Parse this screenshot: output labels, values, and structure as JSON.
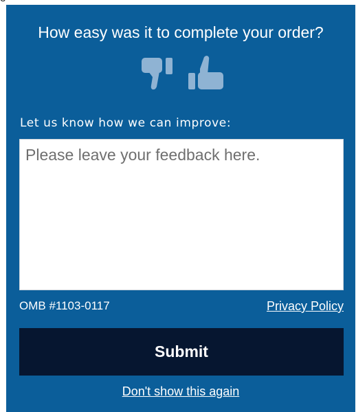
{
  "background_text": "e",
  "survey": {
    "question": "How easy was it to complete your order?",
    "feedback_label": "Let us know how we can improve:",
    "feedback_placeholder": "Please leave your feedback here.",
    "feedback_value": "",
    "omb_number": "OMB #1103-0117",
    "privacy_link": "Privacy Policy",
    "submit_label": "Submit",
    "dont_show_link": "Don't show this again"
  },
  "icons": {
    "thumbs_down": "thumbs-down-icon",
    "thumbs_up": "thumbs-up-icon"
  },
  "colors": {
    "panel_background": "#0b5e9a",
    "icon_color": "#8fb3d3",
    "submit_background": "#061630",
    "text_light": "#ffffff"
  }
}
